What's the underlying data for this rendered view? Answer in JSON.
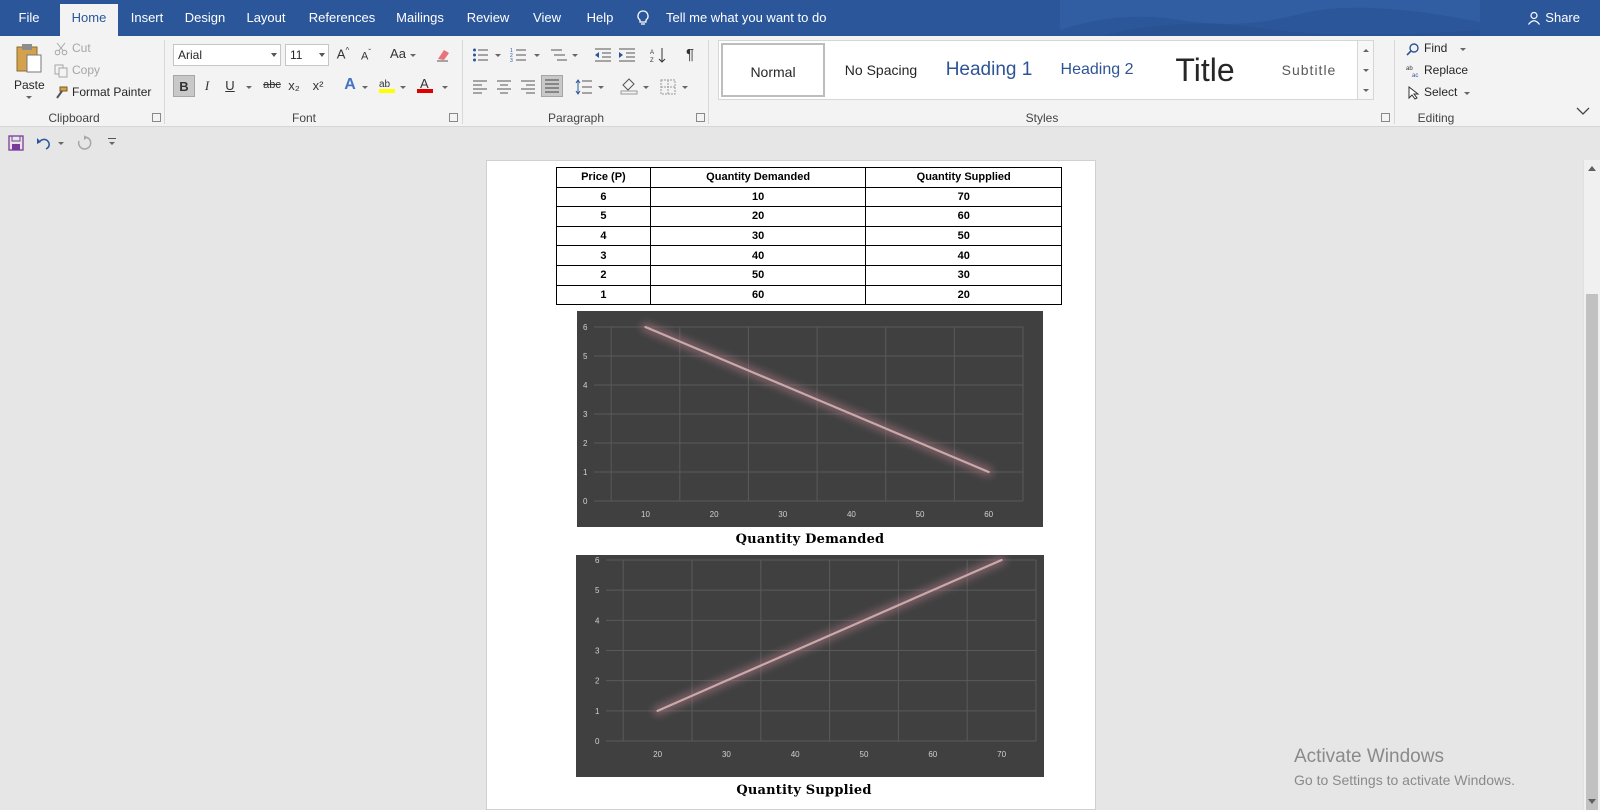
{
  "tabs": [
    "File",
    "Home",
    "Insert",
    "Design",
    "Layout",
    "References",
    "Mailings",
    "Review",
    "View",
    "Help"
  ],
  "active_tab": "Home",
  "tell_me": "Tell me what you want to do",
  "share": "Share",
  "clipboard": {
    "paste": "Paste",
    "cut": "Cut",
    "copy": "Copy",
    "format_painter": "Format Painter",
    "label": "Clipboard"
  },
  "font": {
    "name": "Arial",
    "size": "11",
    "label": "Font",
    "change_case": "Aa",
    "bold": "B",
    "italic": "I",
    "underline": "U",
    "strikethrough": "abc",
    "subscript": "x₂",
    "superscript": "x²"
  },
  "paragraph": {
    "label": "Paragraph"
  },
  "styles": {
    "label": "Styles",
    "items": [
      "Normal",
      "No Spacing",
      "Heading 1",
      "Heading 2",
      "Title",
      "Subtitle"
    ],
    "selected": "Normal"
  },
  "editing": {
    "label": "Editing",
    "find": "Find",
    "replace": "Replace",
    "select": "Select"
  },
  "document": {
    "table": {
      "headers": [
        "Price (P)",
        "Quantity Demanded",
        "Quantity Supplied"
      ],
      "rows": [
        [
          "6",
          "10",
          "70"
        ],
        [
          "5",
          "20",
          "60"
        ],
        [
          "4",
          "30",
          "50"
        ],
        [
          "3",
          "40",
          "40"
        ],
        [
          "2",
          "50",
          "30"
        ],
        [
          "1",
          "60",
          "20"
        ]
      ]
    },
    "caption_demand": "Quantity Demanded",
    "caption_supply": "Quantity Supplied"
  },
  "chart_data": [
    {
      "type": "line",
      "title": "",
      "xlabel": "",
      "ylabel": "",
      "x": [
        10,
        20,
        30,
        40,
        50,
        60
      ],
      "y": [
        6,
        5,
        4,
        3,
        2,
        1
      ],
      "xticks": [
        "10",
        "20",
        "30",
        "40",
        "50",
        "60"
      ],
      "yticks": [
        "0",
        "1",
        "2",
        "3",
        "4",
        "5",
        "6"
      ],
      "xlim": [
        2.5,
        65
      ],
      "ylim": [
        0,
        6
      ],
      "grid": true,
      "background": "#404040",
      "line_color": "#c9a9a9"
    },
    {
      "type": "line",
      "title": "",
      "xlabel": "",
      "ylabel": "",
      "x": [
        20,
        30,
        40,
        50,
        60,
        70
      ],
      "y": [
        1,
        2,
        3,
        4,
        5,
        6
      ],
      "xticks": [
        "20",
        "30",
        "40",
        "50",
        "60",
        "70"
      ],
      "yticks": [
        "0",
        "1",
        "2",
        "3",
        "4",
        "5",
        "6"
      ],
      "xlim": [
        12.5,
        75
      ],
      "ylim": [
        0,
        6
      ],
      "grid": true,
      "background": "#404040",
      "line_color": "#c9a9a9"
    }
  ],
  "watermark": {
    "line1": "Activate Windows",
    "line2": "Go to Settings to activate Windows."
  },
  "colors": {
    "title_bar": "#2b579a",
    "ribbon": "#f3f3f3",
    "canvas": "#e6e6e6"
  }
}
